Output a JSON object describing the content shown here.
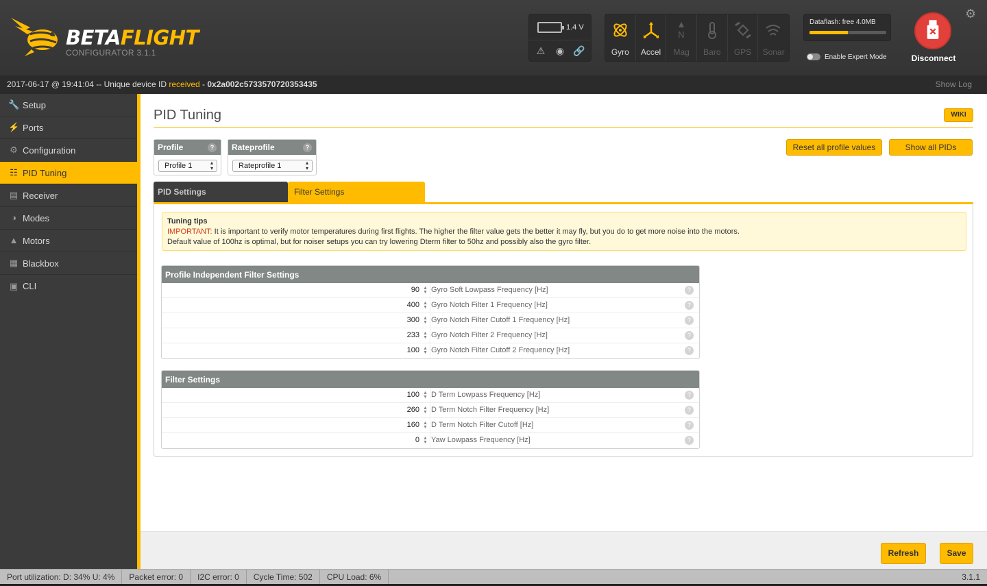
{
  "app": {
    "name_part1": "BETA",
    "name_part2": "FLIGHT",
    "subtitle": "CONFIGURATOR  3.1.1",
    "brand_color": "#ffbb00"
  },
  "header": {
    "battery_voltage": "1.4 V",
    "battery_icons": [
      "warning-icon",
      "parachute-icon",
      "link-icon"
    ],
    "sensors": [
      {
        "label": "Gyro",
        "active": true,
        "icon": "gyro-icon"
      },
      {
        "label": "Accel",
        "active": true,
        "icon": "accel-icon"
      },
      {
        "label": "Mag",
        "active": false,
        "icon": "mag-icon"
      },
      {
        "label": "Baro",
        "active": false,
        "icon": "baro-icon"
      },
      {
        "label": "GPS",
        "active": false,
        "icon": "gps-icon"
      },
      {
        "label": "Sonar",
        "active": false,
        "icon": "sonar-icon"
      }
    ],
    "dataflash_label": "Dataflash: free 4.0MB",
    "dataflash_fill_fraction": 0.5,
    "expert_mode_label": "Enable Expert Mode",
    "expert_mode_on": false,
    "disconnect_label": "Disconnect"
  },
  "logbar": {
    "timestamp": "2017-06-17 @ 19:41:04",
    "text_before": " -- Unique device ID ",
    "received": "received",
    "dash": " - ",
    "device_id": "0x2a002c5733570720353435",
    "show_log": "Show Log"
  },
  "sidebar": {
    "items": [
      {
        "label": "Setup",
        "icon": "wrench-icon",
        "active": false
      },
      {
        "label": "Ports",
        "icon": "plug-icon",
        "active": false
      },
      {
        "label": "Configuration",
        "icon": "gear-icon",
        "active": false
      },
      {
        "label": "PID Tuning",
        "icon": "sitemap-icon",
        "active": true
      },
      {
        "label": "Receiver",
        "icon": "receiver-icon",
        "active": false
      },
      {
        "label": "Modes",
        "icon": "toggle-icon",
        "active": false
      },
      {
        "label": "Motors",
        "icon": "motor-icon",
        "active": false
      },
      {
        "label": "Blackbox",
        "icon": "blackbox-icon",
        "active": false
      },
      {
        "label": "CLI",
        "icon": "terminal-icon",
        "active": false
      }
    ]
  },
  "main": {
    "title": "PID Tuning",
    "wiki": "WIKI",
    "profile": {
      "header": "Profile",
      "selected": "Profile 1"
    },
    "rateprofile": {
      "header": "Rateprofile",
      "selected": "Rateprofile 1"
    },
    "reset_button": "Reset all profile values",
    "show_pids_button": "Show all PIDs",
    "tabs": [
      {
        "label": "PID Settings",
        "active": false
      },
      {
        "label": "Filter Settings",
        "active": true
      }
    ],
    "tips": {
      "title": "Tuning tips",
      "important": "IMPORTANT:",
      "line1": " It is important to verify motor temperatures during first flights. The higher the filter value gets the better it may fly, but you do to get more noise into the motors.",
      "line2": "Default value of 100hz is optimal, but for noiser setups you can try lowering Dterm filter to 50hz and possibly also the gyro filter."
    },
    "profile_independent": {
      "header": "Profile Independent Filter Settings",
      "rows": [
        {
          "value": "90",
          "label": "Gyro Soft Lowpass Frequency [Hz]"
        },
        {
          "value": "400",
          "label": "Gyro Notch Filter 1 Frequency [Hz]"
        },
        {
          "value": "300",
          "label": "Gyro Notch Filter Cutoff 1 Frequency [Hz]"
        },
        {
          "value": "233",
          "label": "Gyro Notch Filter 2 Frequency [Hz]"
        },
        {
          "value": "100",
          "label": "Gyro Notch Filter Cutoff 2 Frequency [Hz]"
        }
      ]
    },
    "filter_settings": {
      "header": "Filter Settings",
      "rows": [
        {
          "value": "100",
          "label": "D Term Lowpass Frequency [Hz]"
        },
        {
          "value": "260",
          "label": "D Term Notch Filter Frequency [Hz]"
        },
        {
          "value": "160",
          "label": "D Term Notch Filter Cutoff [Hz]"
        },
        {
          "value": "0",
          "label": "Yaw Lowpass Frequency [Hz]"
        }
      ]
    },
    "refresh_button": "Refresh",
    "save_button": "Save"
  },
  "statusbar": {
    "port_util": "Port utilization: D: 34% U: 4%",
    "packet_error": "Packet error: 0",
    "i2c_error": "I2C error: 0",
    "cycle_time": "Cycle Time: 502",
    "cpu_load": "CPU Load: 6%",
    "version": "3.1.1"
  }
}
